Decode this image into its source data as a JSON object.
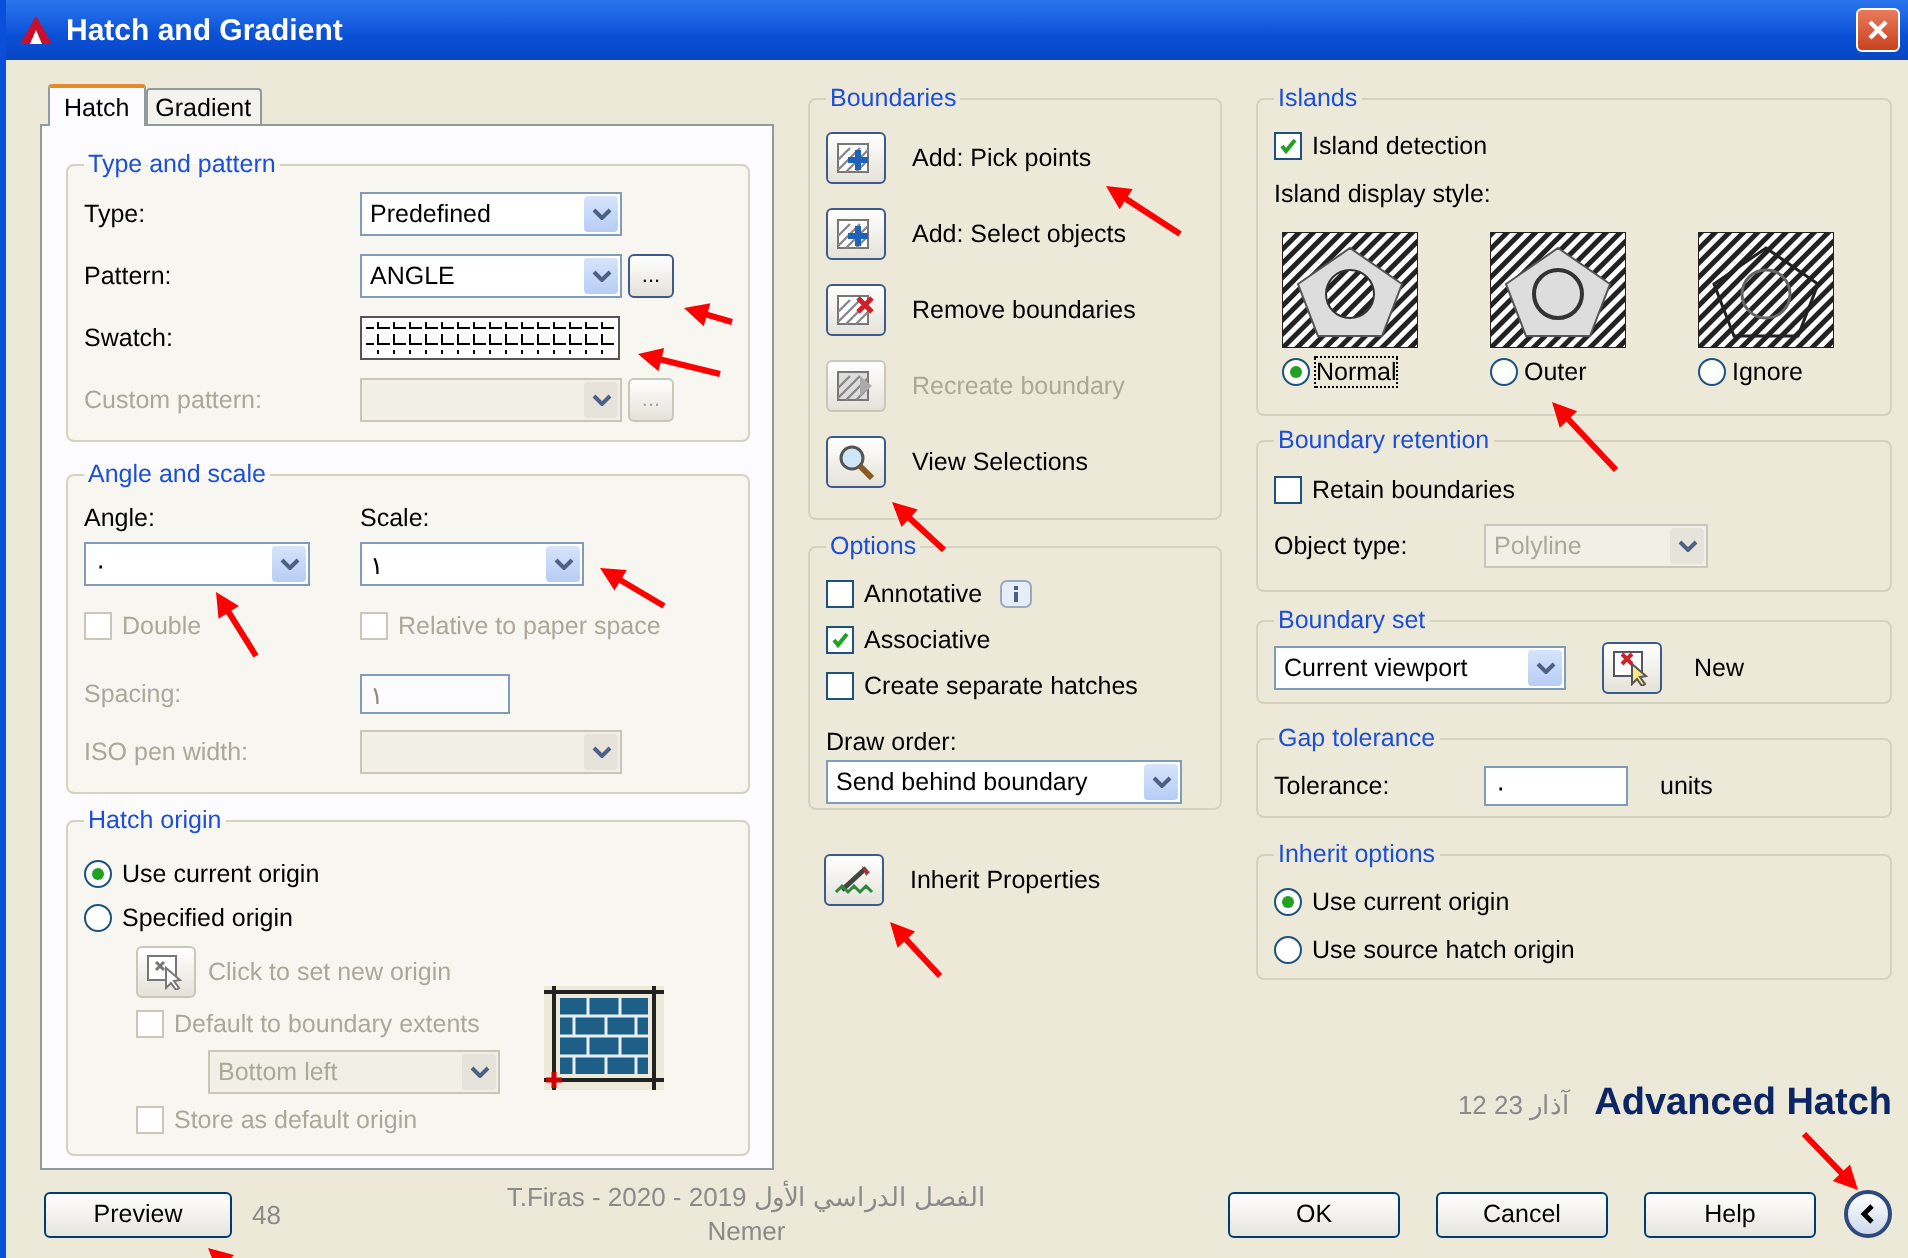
{
  "window": {
    "title": "Hatch and Gradient"
  },
  "tabs": [
    {
      "label": "Hatch",
      "selected": true
    },
    {
      "label": "Gradient",
      "selected": false
    }
  ],
  "type_and_pattern": {
    "title": "Type and pattern",
    "rows": [
      {
        "kind": "select",
        "label": "Type:",
        "value": "Predefined",
        "disabled": false
      },
      {
        "kind": "select_browse",
        "label": "Pattern:",
        "value": "ANGLE",
        "browse": "...",
        "disabled": false
      },
      {
        "kind": "swatch",
        "label": "Swatch:",
        "disabled": false
      },
      {
        "kind": "select_browse",
        "label": "Custom pattern:",
        "browse": "...",
        "disabled": true
      }
    ]
  },
  "angle_and_scale": {
    "title": "Angle and scale",
    "angle": {
      "label": "Angle:",
      "value": "٠"
    },
    "scale": {
      "label": "Scale:",
      "value": "١"
    },
    "checkboxes": [
      {
        "label": "Double",
        "checked": false,
        "disabled": true
      },
      {
        "label": "Relative to paper space",
        "checked": false,
        "disabled": true
      }
    ],
    "spacing": {
      "label": "Spacing:",
      "value": "١",
      "disabled": true
    },
    "iso_pen_width": {
      "label": "ISO pen width:",
      "disabled": true
    }
  },
  "hatch_origin": {
    "title": "Hatch origin",
    "radios": [
      {
        "label": "Use current origin",
        "selected": true
      },
      {
        "label": "Specified origin",
        "selected": false
      }
    ],
    "set_origin": {
      "label": "Click to set new origin",
      "disabled": true
    },
    "default_to_extents": {
      "label": "Default to boundary extents",
      "checked": false,
      "disabled": true
    },
    "position": {
      "value": "Bottom left",
      "disabled": true
    },
    "store_default": {
      "label": "Store as default origin",
      "checked": false,
      "disabled": true
    }
  },
  "boundaries": {
    "title": "Boundaries",
    "actions": [
      {
        "kind": "pick",
        "label": "Add: Pick points",
        "disabled": false
      },
      {
        "kind": "select",
        "label": "Add: Select objects",
        "disabled": false
      },
      {
        "kind": "remove",
        "label": "Remove boundaries",
        "disabled": false
      },
      {
        "kind": "recreate",
        "label": "Recreate boundary",
        "disabled": true
      },
      {
        "kind": "view",
        "label": "View Selections",
        "disabled": false
      }
    ]
  },
  "options": {
    "title": "Options",
    "checkboxes": [
      {
        "label": "Annotative",
        "checked": false,
        "info": true
      },
      {
        "label": "Associative",
        "checked": true,
        "info": false
      },
      {
        "label": "Create separate hatches",
        "checked": false,
        "info": false
      }
    ],
    "draw_order": {
      "label": "Draw order:",
      "value": "Send behind boundary"
    }
  },
  "inherit_properties": {
    "label": "Inherit Properties"
  },
  "islands": {
    "title": "Islands",
    "detection": {
      "label": "Island detection",
      "checked": true
    },
    "style_label": "Island display style:",
    "styles": [
      {
        "kind": "normal",
        "label": "Normal",
        "selected": true
      },
      {
        "kind": "outer",
        "label": "Outer",
        "selected": false
      },
      {
        "kind": "ignore",
        "label": "Ignore",
        "selected": false
      }
    ]
  },
  "boundary_retention": {
    "title": "Boundary retention",
    "retain": {
      "label": "Retain boundaries",
      "checked": false
    },
    "object_type": {
      "label": "Object type:",
      "value": "Polyline",
      "disabled": true
    }
  },
  "boundary_set": {
    "title": "Boundary set",
    "value": "Current viewport",
    "new_label": "New"
  },
  "gap_tolerance": {
    "title": "Gap tolerance",
    "label": "Tolerance:",
    "value": "٠",
    "units": "units"
  },
  "inherit_options": {
    "title": "Inherit options",
    "radios": [
      {
        "label": "Use current origin",
        "selected": true
      },
      {
        "label": "Use source hatch origin",
        "selected": false
      }
    ]
  },
  "slide_title": "Advanced Hatch",
  "slide_date": "12 آذار 23",
  "footer": {
    "preview": "Preview",
    "page_number": "48",
    "credit": "T.Firas  -  2020 - 2019 الفصل الدراسي الأول",
    "credit_name": "Nemer",
    "buttons": [
      "OK",
      "Cancel",
      "Help"
    ]
  }
}
